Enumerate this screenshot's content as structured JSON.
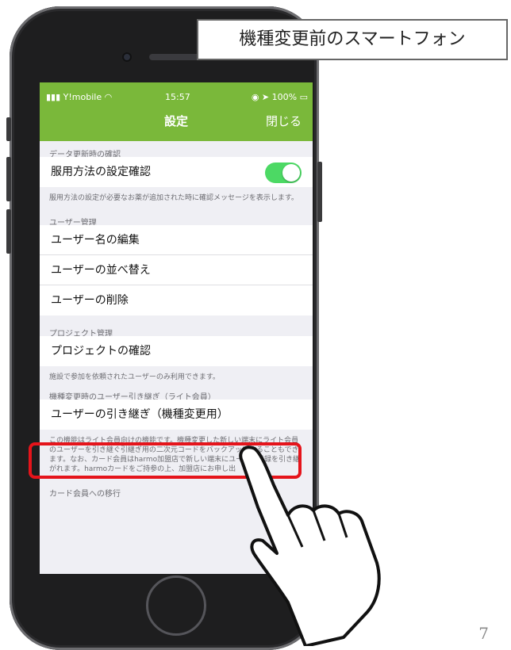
{
  "callout": {
    "text": "機種変更前のスマートフォン"
  },
  "status_bar": {
    "carrier": "Y!mobile",
    "time": "15:57",
    "battery": "100%"
  },
  "nav": {
    "title": "設定",
    "close_label": "閉じる"
  },
  "sections": {
    "data_update": {
      "header": "データ更新時の確認",
      "item": "服用方法の設定確認",
      "toggle_on": true,
      "footer": "服用方法の設定が必要なお薬が追加された時に確認メッセージを表示します。"
    },
    "user_management": {
      "header": "ユーザー管理",
      "items": [
        "ユーザー名の編集",
        "ユーザーの並べ替え",
        "ユーザーの削除"
      ]
    },
    "project_management": {
      "header": "プロジェクト管理",
      "item": "プロジェクトの確認",
      "footer": "施設で参加を依頼されたユーザーのみ利用できます。"
    },
    "user_transfer": {
      "header": "機種変更時のユーザー引き継ぎ（ライト会員）",
      "item": "ユーザーの引き継ぎ（機種変更用）",
      "footer": "この機能はライト会員向けの機能です。機種変更した新しい端末にライト会員のユーザーを引き継ぐ引継ぎ用の二次元コードをバックアップすることもできます。なお、カード会員はharmo加盟店で新しい端末にユーザー登録を引き継がれます。harmoカードをご持参の上、加盟店にお申し出"
    },
    "card_migration": {
      "header": "カード会員への移行"
    }
  },
  "page_number": "7",
  "colors": {
    "nav_green": "#7ab83a",
    "toggle_green": "#4cd964",
    "highlight_red": "#e5141b"
  }
}
